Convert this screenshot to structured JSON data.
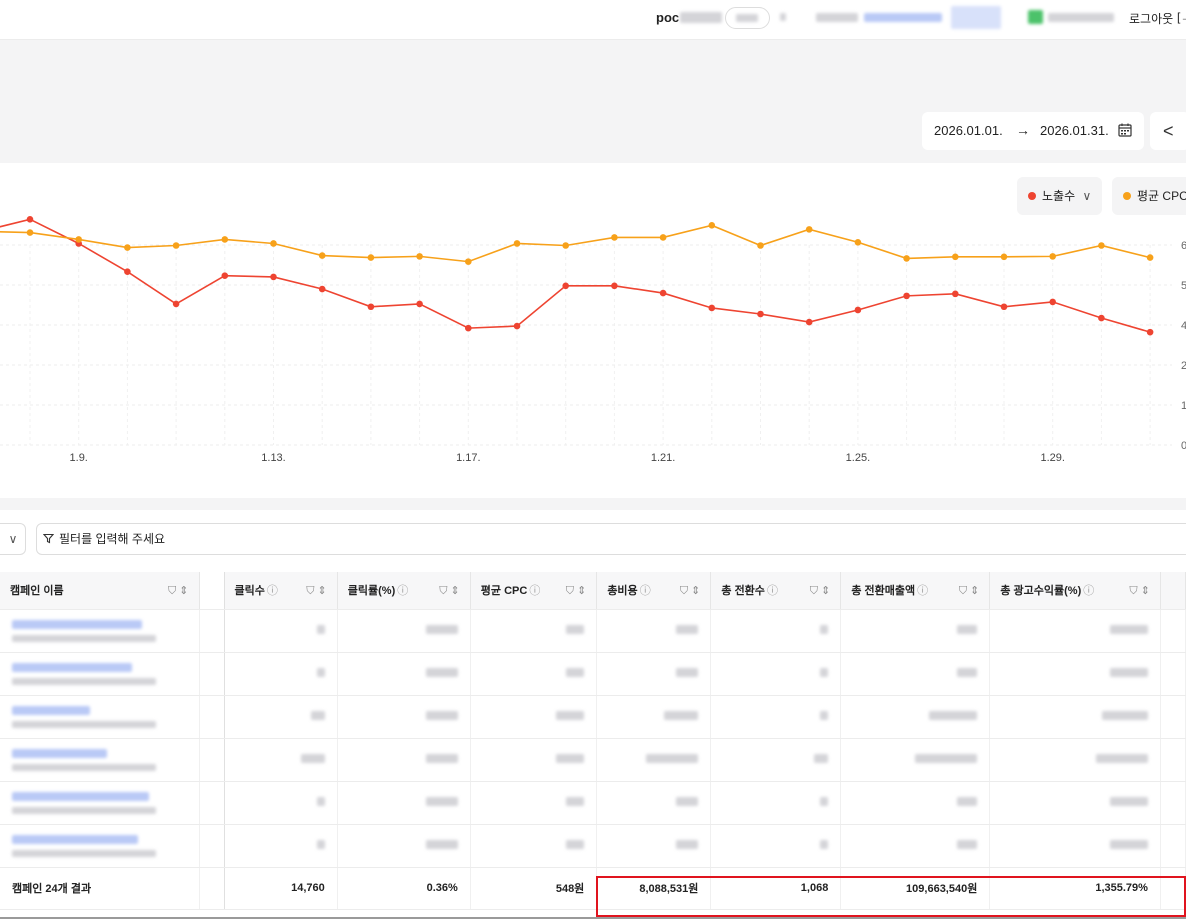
{
  "header": {
    "account_prefix": "poc",
    "logout_label": "로그아웃",
    "logout_icon": "[→"
  },
  "date_range": {
    "start": "2026.01.01.",
    "arrow": "→",
    "end": "2026.01.31.",
    "prev_glyph": "<"
  },
  "chart": {
    "metric1_label": "노출수",
    "metric1_chevron": "∨",
    "metric2_label": "평균 CPC",
    "colors": {
      "metric1": "#ee4431",
      "metric2": "#f7a11a"
    }
  },
  "chart_data": {
    "type": "line",
    "x": [
      7,
      8,
      9,
      10,
      11,
      12,
      13,
      14,
      15,
      16,
      17,
      18,
      19,
      20,
      21,
      22,
      23,
      24,
      25,
      26,
      27,
      28,
      29,
      30
    ],
    "x_tick_labels": [
      "1.9.",
      "1.13.",
      "1.17.",
      "1.21.",
      "1.25.",
      "1.29."
    ],
    "x_tick_values": [
      9,
      13,
      17,
      21,
      25,
      29
    ],
    "y_tick_labels": [
      "6",
      "5",
      "4",
      "2",
      "1",
      "0"
    ],
    "series": [
      {
        "name": "노출수",
        "color": "#ee4431",
        "values": [
          5.35,
          5.65,
          5.05,
          4.35,
          3.55,
          4.25,
          4.22,
          3.92,
          3.48,
          3.55,
          2.95,
          3.0,
          4.0,
          4.0,
          3.82,
          3.45,
          3.3,
          3.1,
          3.4,
          3.75,
          3.8,
          3.48,
          3.6,
          3.2,
          2.85
        ]
      },
      {
        "name": "평균 CPC",
        "color": "#f7a11a",
        "values": [
          5.35,
          5.32,
          5.15,
          4.95,
          5.0,
          5.15,
          5.05,
          4.75,
          4.7,
          4.73,
          4.6,
          5.05,
          5.0,
          5.2,
          5.2,
          5.5,
          5.0,
          5.4,
          5.08,
          4.68,
          4.72,
          4.72,
          4.73,
          5.0,
          4.7
        ]
      }
    ]
  },
  "filter": {
    "dropdown_glyph": "∨",
    "placeholder": "필터를 입력해 주세요"
  },
  "table": {
    "columns": [
      "캠페인 이름",
      "클릭수",
      "클릭률(%)",
      "평균 CPC",
      "총비용",
      "총 전환수",
      "총 전환매출액",
      "총 광고수익률(%)"
    ],
    "total_row": {
      "label": "캠페인 24개 결과",
      "clicks": "14,760",
      "ctr": "0.36%",
      "cpc": "548원",
      "cost": "8,088,531원",
      "conversions": "1,068",
      "revenue": "109,663,540원",
      "roas": "1,355.79%"
    }
  }
}
